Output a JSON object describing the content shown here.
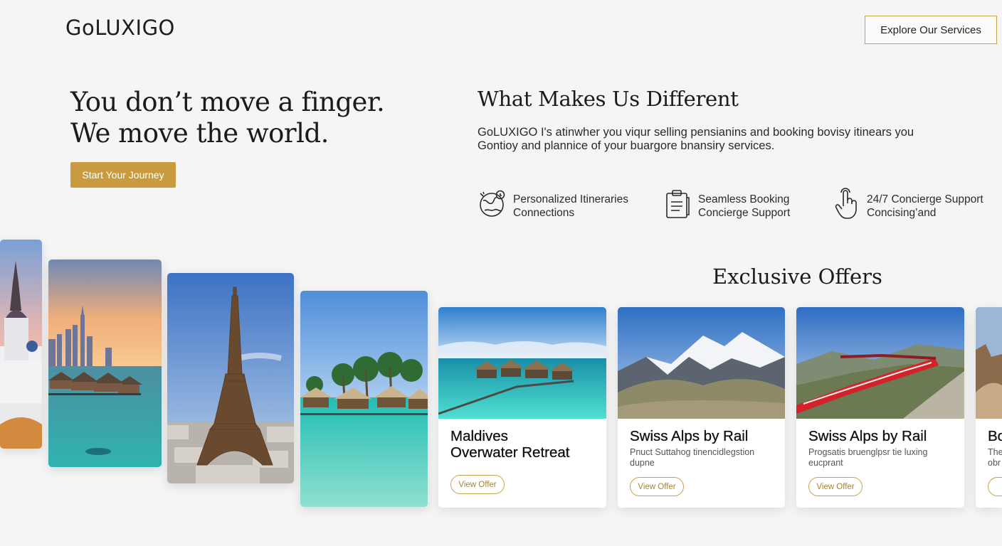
{
  "header": {
    "logo": "GoLUXIGO",
    "explore_label": "Explore Our Services"
  },
  "hero": {
    "title_line1": "You don’t move a finger.",
    "title_line2": "We move the world.",
    "cta_label": "Start Your Journey"
  },
  "different": {
    "title": "What Makes Us Different",
    "text_line1": "GoLUXIGO I's atinwher you viqur selling pensianins and booking bovisy itinears you",
    "text_line2": "Gontioy and plannice of your buargore bnansiry services.",
    "features": [
      {
        "icon": "globe-icon",
        "line1": "Personalized Itineraries",
        "line2": "Connections"
      },
      {
        "icon": "clipboard-icon",
        "line1": "Seamless Booking",
        "line2": "Concierge Support"
      },
      {
        "icon": "hand-pointer-icon",
        "line1": "24/7 Concierge Support",
        "line2": "Concising’and"
      }
    ]
  },
  "offers": {
    "title": "Exclusive Offers",
    "cards": [
      {
        "title_line1": "Maldives",
        "title_line2": "Overwater Retreat",
        "desc_line1": "",
        "desc_line2": "",
        "button": "View Offer",
        "image": "maldives-overwater-villas"
      },
      {
        "title_line1": "Swiss Alps by Rail",
        "title_line2": "",
        "desc_line1": "Pnuct Suttahog tinencidlegstion",
        "desc_line2": "dupne",
        "button": "View Offer",
        "image": "snowy-mountain"
      },
      {
        "title_line1": "Swiss Alps by Rail",
        "title_line2": "",
        "desc_line1": "Progsatis bruenglpsr tie luxing",
        "desc_line2": "eucprant",
        "button": "View Offer",
        "image": "red-train-mountains"
      },
      {
        "title_line1": "Bo",
        "title_line2": "",
        "desc_line1": "The",
        "desc_line2": "obr",
        "button": "",
        "image": "desert-rocks"
      }
    ]
  },
  "gallery": [
    "santorini",
    "dubai-overwater",
    "eiffel-tower",
    "tropical-bungalows"
  ],
  "colors": {
    "gold": "#c99b3f",
    "gold_border": "#c9a14e",
    "background": "#f5f5f5"
  }
}
